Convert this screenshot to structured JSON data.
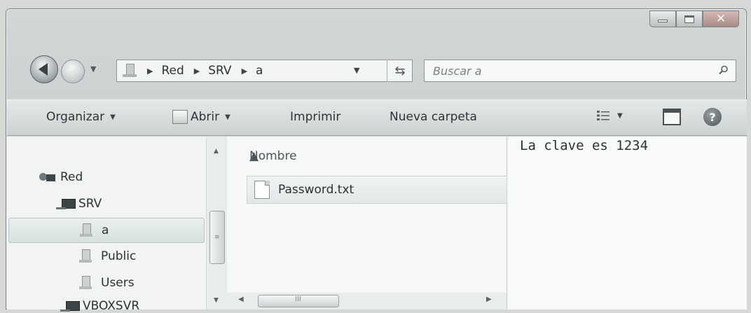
{
  "address_bar": {
    "breadcrumbs": [
      "Red",
      "SRV",
      "a"
    ]
  },
  "search": {
    "placeholder": "Buscar a"
  },
  "toolbar": {
    "organize_label": "Organizar",
    "open_label": "Abrir",
    "print_label": "Imprimir",
    "new_folder_label": "Nueva carpeta",
    "icons": [
      "view-options-icon",
      "preview-pane-icon",
      "help-icon"
    ]
  },
  "navigation_tree": {
    "items": [
      {
        "label": "Red",
        "icon": "network-icon"
      },
      {
        "label": "SRV",
        "icon": "computer-icon"
      },
      {
        "label": "a",
        "icon": "shared-folder-icon",
        "selected": true
      },
      {
        "label": "Public",
        "icon": "shared-folder-icon"
      },
      {
        "label": "Users",
        "icon": "shared-folder-icon"
      },
      {
        "label": "VBOXSVR",
        "icon": "computer-icon"
      }
    ]
  },
  "file_list": {
    "column_header": "Nombre",
    "files": [
      {
        "name": "Password.txt",
        "icon": "text-file-icon",
        "selected": true
      }
    ]
  },
  "preview": {
    "content": "La clave es 1234"
  }
}
